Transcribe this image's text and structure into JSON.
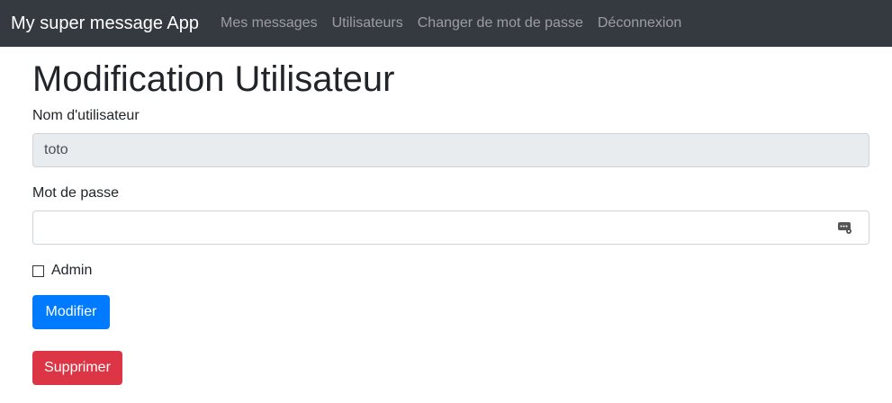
{
  "navbar": {
    "brand": "My super message App",
    "links": [
      {
        "label": "Mes messages"
      },
      {
        "label": "Utilisateurs"
      },
      {
        "label": "Changer de mot de passe"
      },
      {
        "label": "Déconnexion"
      }
    ],
    "background": "#343a40"
  },
  "form": {
    "title": "Modification Utilisateur",
    "username_label": "Nom d'utilisateur",
    "username_value": "toto",
    "password_label": "Mot de passe",
    "password_value": "",
    "admin_label": "Admin",
    "admin_checked": false,
    "submit_label": "Modifier",
    "delete_label": "Supprimer"
  },
  "colors": {
    "primary": "#007bff",
    "danger": "#dc3545",
    "readonly_bg": "#e9ecef"
  }
}
